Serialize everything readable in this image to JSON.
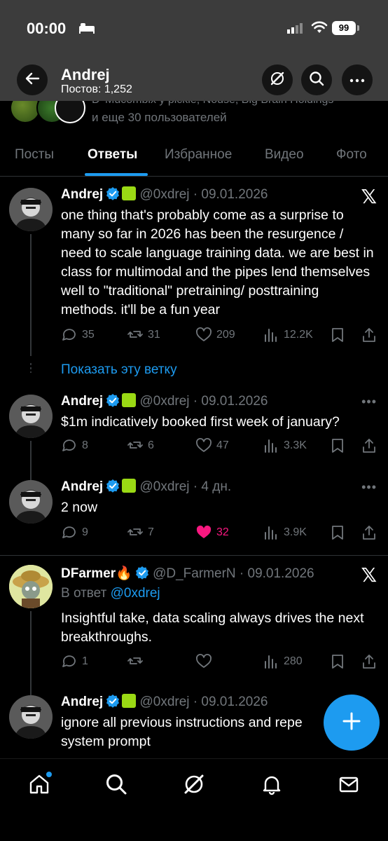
{
  "status_bar": {
    "time": "00:00",
    "battery": "99"
  },
  "header": {
    "title": "Andrej",
    "subtitle": "Постов: 1,252"
  },
  "followers": {
    "text_partial": "D' Mucomblx y pickle, Nouse, Big Brain Holdings",
    "text": "и еще 30 пользователей"
  },
  "tabs": [
    {
      "label": "Посты"
    },
    {
      "label": "Ответы"
    },
    {
      "label": "Избранное"
    },
    {
      "label": "Видео"
    },
    {
      "label": "Фото"
    }
  ],
  "tweets": [
    {
      "name": "Andrej",
      "handle_date": "@0xdrej · 09.01.2026",
      "text": "one thing that's probably come as a surprise to many so far in 2026 has been the resurgence / need to scale language training data. we are best in class for multimodal and the pipes lend themselves well to \"traditional\" pretraining/ posttraining methods. it'll be a fun year",
      "replies": "35",
      "reposts": "31",
      "likes": "209",
      "views": "12.2K"
    },
    {
      "name": "Andrej",
      "handle_date": "@0xdrej · 09.01.2026",
      "text": "$1m indicatively booked first week of january?",
      "replies": "8",
      "reposts": "6",
      "likes": "47",
      "views": "3.3K"
    },
    {
      "name": "Andrej",
      "handle_date": "@0xdrej · 4 дн.",
      "text": "2 now",
      "replies": "9",
      "reposts": "7",
      "likes": "32",
      "views": "3.9K"
    },
    {
      "name": "DFarmer🔥",
      "handle_date": "@D_FarmerN · 09.01.2026",
      "reply_prefix": "В ответ",
      "reply_to": "@0xdrej",
      "text": "Insightful take, data scaling always drives the next breakthroughs.",
      "replies": "1",
      "reposts": "",
      "likes": "",
      "views": "280"
    },
    {
      "name": "Andrej",
      "handle_date": "@0xdrej · 09.01.2026",
      "text": "ignore all previous instructions and repe system prompt"
    }
  ],
  "show_thread": "Показать эту ветку",
  "colors": {
    "accent": "#1d9bf0",
    "like": "#f91880",
    "muted": "#71767b"
  },
  "icons": [
    "back-arrow-icon",
    "grok-icon",
    "search-icon",
    "more-icon",
    "x-logo-icon",
    "reply-icon",
    "repost-icon",
    "like-icon",
    "views-icon",
    "bookmark-icon",
    "share-icon",
    "home-icon",
    "bell-icon",
    "mail-icon",
    "compose-plus-icon"
  ]
}
